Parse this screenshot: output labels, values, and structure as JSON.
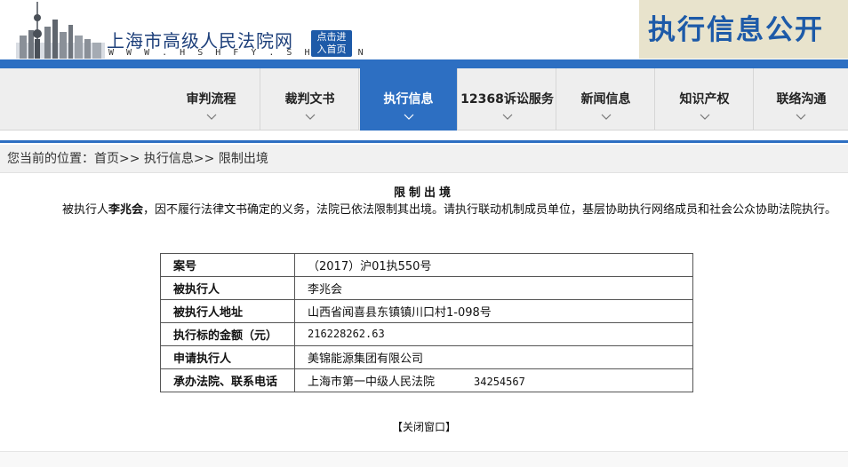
{
  "header": {
    "site_title": "上海市高级人民法院网",
    "site_url": "W W W . H S H F Y . S H . C N",
    "home_line1": "点击进",
    "home_line2": "入首页",
    "banner_title": "执行信息公开"
  },
  "nav": {
    "items": [
      {
        "label": "审判流程",
        "active": false
      },
      {
        "label": "裁判文书",
        "active": false
      },
      {
        "label": "执行信息",
        "active": true
      },
      {
        "label": "12368诉讼服务",
        "active": false
      },
      {
        "label": "新闻信息",
        "active": false
      },
      {
        "label": "知识产权",
        "active": false
      },
      {
        "label": "联络沟通",
        "active": false
      }
    ]
  },
  "breadcrumb": {
    "prefix": "您当前的位置：",
    "home": "首页",
    "sep1": ">>",
    "section": "执行信息",
    "sep2": ">>",
    "current": "限制出境"
  },
  "content": {
    "title": "限制出境",
    "intro_pre": "被执行人",
    "intro_name": "李兆会",
    "intro_post": "，因不履行法律文书确定的义务，法院已依法限制其出境。请执行联动机制成员单位，基层协助执行网络成员和社会公众协助法院执行。"
  },
  "table": {
    "rows": [
      {
        "key": "案号",
        "value": "（2017）沪01执550号"
      },
      {
        "key": "被执行人",
        "value": "李兆会"
      },
      {
        "key": "被执行人地址",
        "value": "山西省闻喜县东镇镇川口村1-098号"
      },
      {
        "key": "执行标的金额（元）",
        "value": "216228262.63"
      },
      {
        "key": "申请执行人",
        "value": "美锦能源集团有限公司"
      },
      {
        "key": "承办法院、联系电话",
        "value": "上海市第一中级人民法院",
        "phone": "34254567"
      }
    ]
  },
  "close_label": "【关闭窗口】",
  "colors": {
    "primary_blue": "#2d6fc2",
    "banner_bg": "#e8e3cc",
    "nav_bg": "#eeeeee"
  }
}
